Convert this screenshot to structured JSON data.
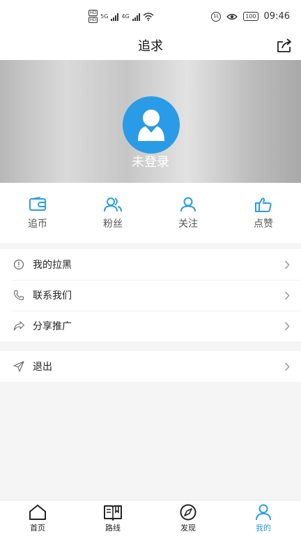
{
  "status_bar": {
    "hd_top": "HD",
    "hd_bottom": "HD",
    "net1": "5G",
    "net2": "4G",
    "circle_text": "1L",
    "battery": "100",
    "time": "09:46"
  },
  "header": {
    "title": "追求",
    "share_icon": "share-icon"
  },
  "profile": {
    "login_text": "未登录",
    "avatar_icon": "user-avatar-icon"
  },
  "stats": [
    {
      "label": "追币",
      "icon": "wallet-icon"
    },
    {
      "label": "粉丝",
      "icon": "fans-icon"
    },
    {
      "label": "关注",
      "icon": "user-icon"
    },
    {
      "label": "点赞",
      "icon": "thumbs-up-icon"
    }
  ],
  "menu": {
    "group1": [
      {
        "label": "我的拉黑",
        "icon": "info-icon"
      },
      {
        "label": "联系我们",
        "icon": "phone-icon"
      },
      {
        "label": "分享推广",
        "icon": "share-arrow-icon"
      }
    ],
    "group2": [
      {
        "label": "退出",
        "icon": "send-icon"
      }
    ]
  },
  "tabbar": [
    {
      "label": "首页",
      "icon": "home-icon",
      "active": false
    },
    {
      "label": "路线",
      "icon": "map-icon",
      "active": false
    },
    {
      "label": "发现",
      "icon": "compass-icon",
      "active": false
    },
    {
      "label": "我的",
      "icon": "profile-icon",
      "active": true
    }
  ],
  "colors": {
    "accent": "#2a9be6",
    "background": "#f5f5f5"
  }
}
